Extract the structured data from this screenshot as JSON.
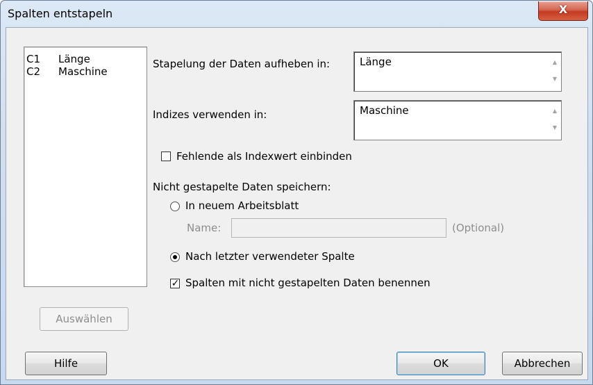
{
  "window": {
    "title": "Spalten entstapeln",
    "close_icon": "close-x-icon",
    "close_glyph": "X"
  },
  "columns": [
    {
      "id": "C1",
      "name": "Länge"
    },
    {
      "id": "C2",
      "name": "Maschine"
    }
  ],
  "form": {
    "unstack_label": "Stapelung der Daten aufheben in:",
    "unstack_value": "Länge",
    "indices_label": "Indizes verwenden in:",
    "indices_value": "Maschine",
    "missing_label": "Fehlende als Indexwert einbinden",
    "missing_checked": false,
    "store_label": "Nicht gestapelte Daten speichern:",
    "new_worksheet_label": "In neuem Arbeitsblatt",
    "name_label": "Name:",
    "name_value": "",
    "optional_label": "(Optional)",
    "after_last_label": "Nach letzter verwendeter Spalte",
    "selected_option": "after_last",
    "name_columns_label": "Spalten mit nicht gestapelten Daten benennen",
    "name_columns_checked": true,
    "scroll_up": "▲",
    "scroll_down": "▼",
    "check_glyph": "✓"
  },
  "buttons": {
    "select": "Auswählen",
    "help": "Hilfe",
    "ok": "OK",
    "cancel": "Abbrechen"
  }
}
